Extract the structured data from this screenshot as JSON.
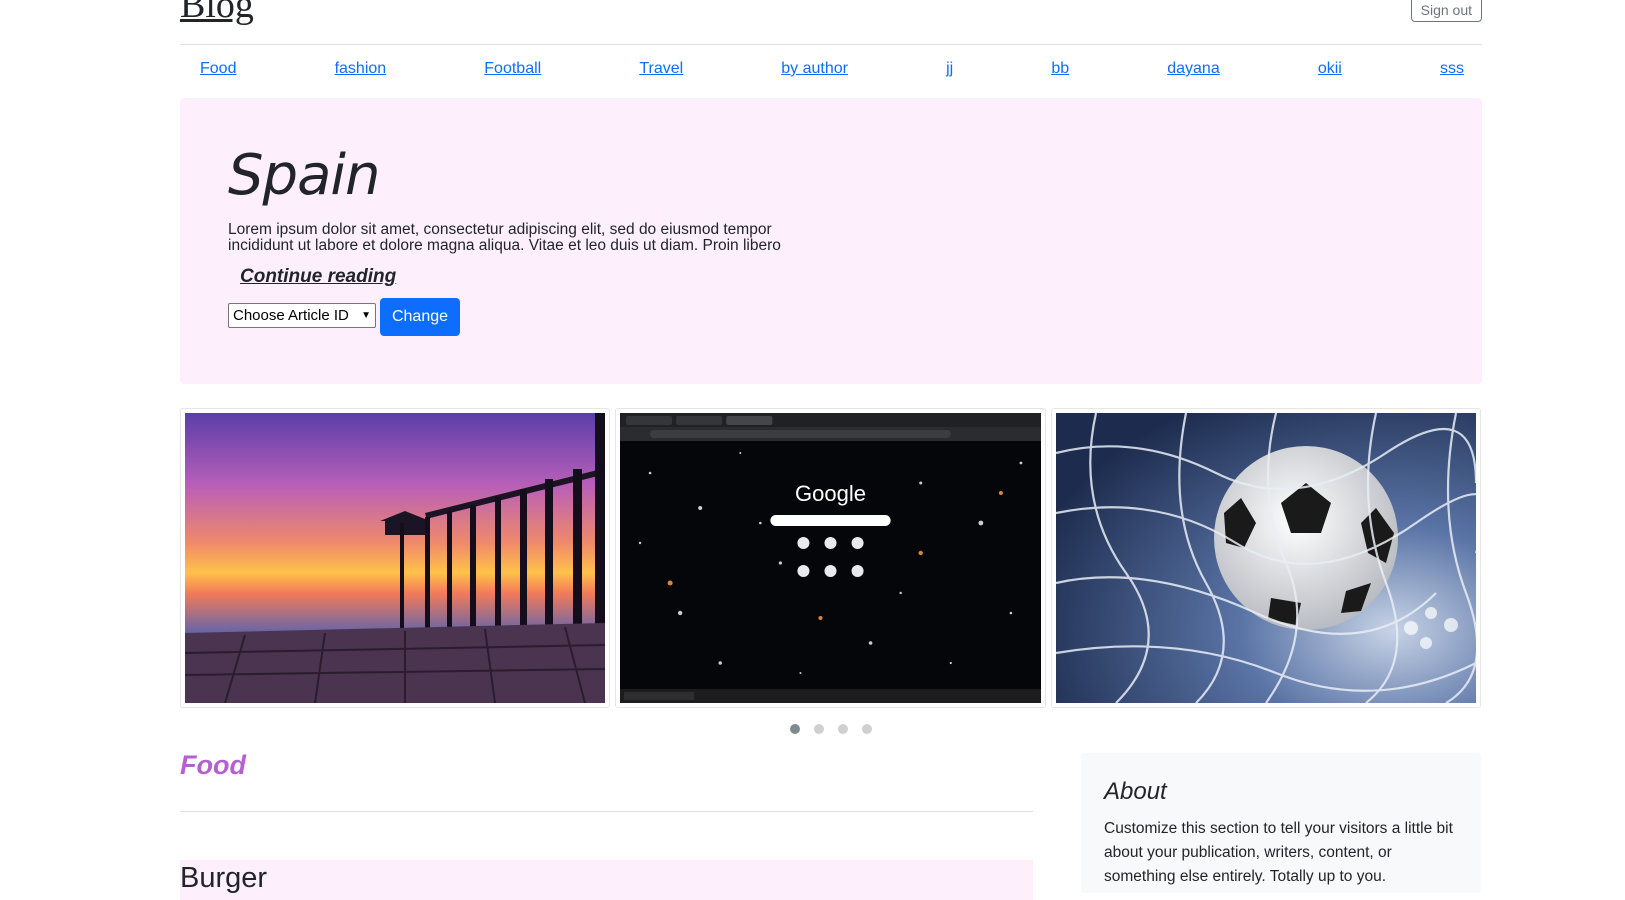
{
  "header": {
    "brand": "Blog",
    "signout_label": "Sign out"
  },
  "nav": {
    "categories": [
      "Food",
      "fashion",
      "Football",
      "Travel",
      "by author",
      "jj",
      "bb",
      "dayana",
      "okii",
      "sss"
    ]
  },
  "hero": {
    "title": "Spain",
    "text": "Lorem ipsum dolor sit amet, consectetur adipiscing elit, sed do eiusmod tempor incididunt ut labore et dolore magna aliqua. Vitae et leo duis ut diam. Proin libero",
    "link_label": "Continue reading",
    "select_value": "Choose Article ID",
    "button_label": "Change"
  },
  "carousel": {
    "slides": [
      "sunset-pier-image",
      "browser-screenshot-image",
      "football-net-image"
    ],
    "screenshot_logo": "Google",
    "dot_count": 4,
    "active_dot": 0
  },
  "section": {
    "title": "Food",
    "first_post": "Burger"
  },
  "about": {
    "title": "About",
    "text": "Customize this section to tell your visitors a little bit about your publication, writers, content, or something else entirely. Totally up to you."
  },
  "colors": {
    "accent": "#0d6efd",
    "hero_bg": "#fdf0fc",
    "section_title": "#b55fd3",
    "sidebar_bg": "#f8f9fa"
  }
}
